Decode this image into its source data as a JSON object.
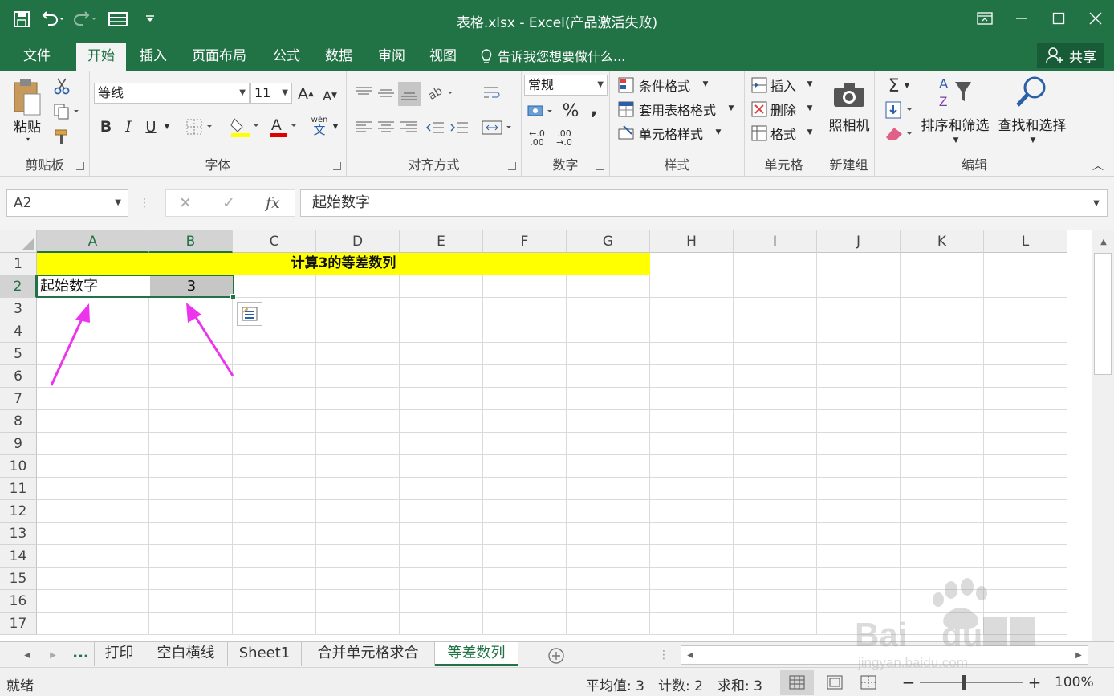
{
  "window": {
    "title": "表格.xlsx - Excel(产品激活失败)"
  },
  "tabs": [
    "文件",
    "开始",
    "插入",
    "页面布局",
    "公式",
    "数据",
    "审阅",
    "视图"
  ],
  "tell_me": "告诉我您想要做什么...",
  "share": "共享",
  "ribbon": {
    "clipboard": {
      "paste": "粘贴",
      "label": "剪贴板"
    },
    "font": {
      "name": "等线",
      "size": "11",
      "label": "字体",
      "bold": "B",
      "italic": "I",
      "underline": "U",
      "phonetic": "wén",
      "phonetic2": "文"
    },
    "alignment": {
      "label": "对齐方式"
    },
    "number": {
      "format": "常规",
      "percent": "%",
      "comma": ",",
      "inc_dec": "←.0 .00",
      "dec_dec": ".00 →.0",
      "label": "数字"
    },
    "styles": {
      "conditional": "条件格式",
      "table": "套用表格格式",
      "cell": "单元格样式",
      "label": "样式"
    },
    "cells": {
      "insert": "插入",
      "delete": "删除",
      "format": "格式",
      "label": "单元格"
    },
    "camera": {
      "name": "照相机",
      "label": "新建组"
    },
    "editing": {
      "sort": "排序和筛选",
      "find": "查找和选择",
      "label": "编辑"
    }
  },
  "formula_bar": {
    "name_box": "A2",
    "fx": "fx",
    "content": "起始数字"
  },
  "columns": [
    "A",
    "B",
    "C",
    "D",
    "E",
    "F",
    "G",
    "H",
    "I",
    "J",
    "K",
    "L"
  ],
  "rows": [
    "1",
    "2",
    "3",
    "4",
    "5",
    "6",
    "7",
    "8",
    "9",
    "10",
    "11",
    "12",
    "13",
    "14",
    "15",
    "16",
    "17"
  ],
  "cells": {
    "title": "计算3的等差数列",
    "a2": "起始数字",
    "b2": "3"
  },
  "sheet_tabs": {
    "more": "...",
    "tabs": [
      "打印",
      "空白横线",
      "Sheet1",
      "合并单元格求合",
      "等差数列"
    ],
    "active": "等差数列"
  },
  "status": {
    "ready": "就绪",
    "average": "平均值: 3",
    "count": "计数: 2",
    "sum": "求和: 3",
    "zoom": "100%"
  },
  "colors": {
    "excel_green": "#217346",
    "highlight_yellow": "#ffff00",
    "arrow_magenta": "#ee33ee"
  }
}
